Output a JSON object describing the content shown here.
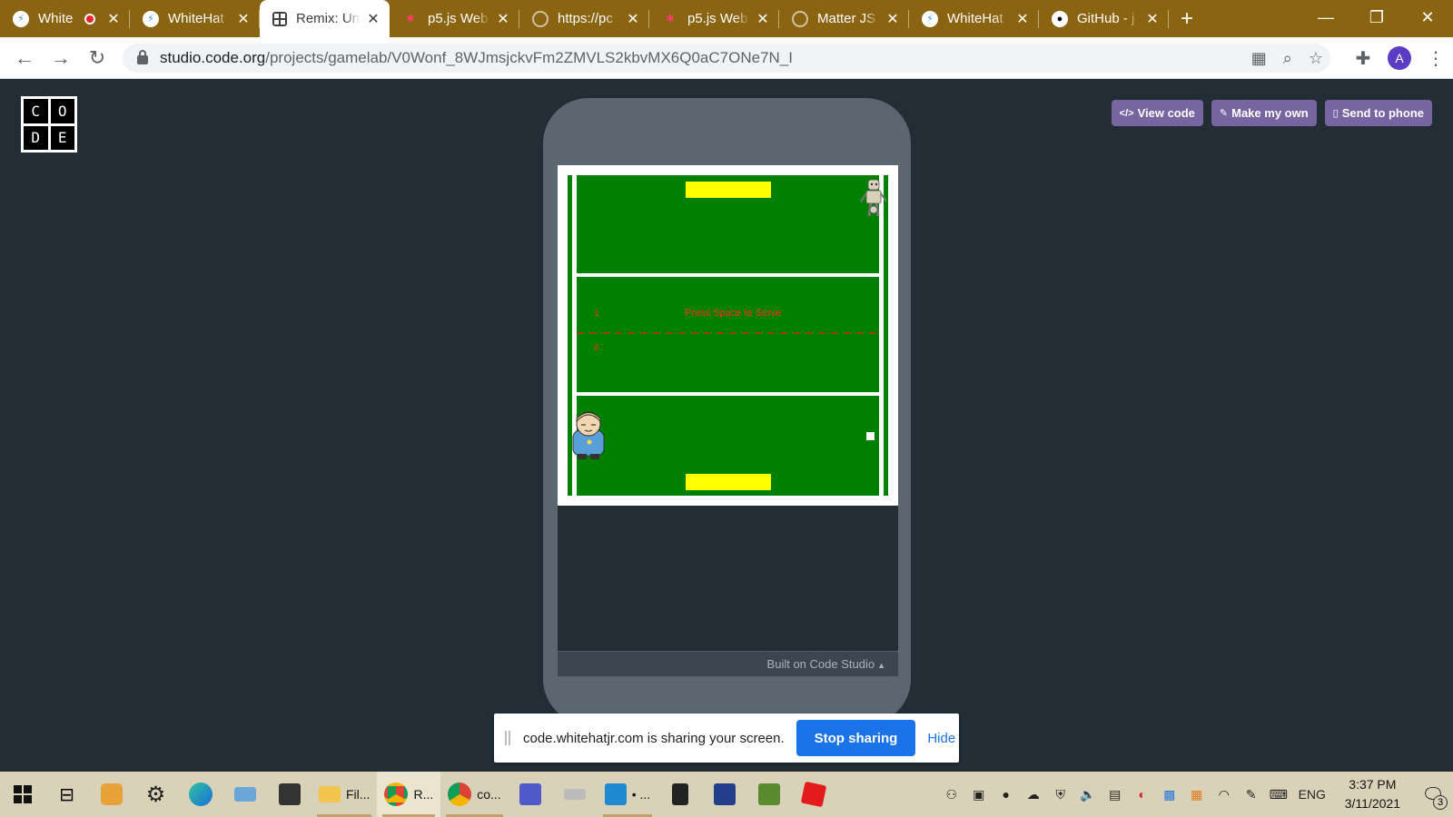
{
  "browser": {
    "tabs": [
      {
        "title": "White",
        "icon": "whitehat-icon",
        "recording": true
      },
      {
        "title": "WhiteHat",
        "icon": "whitehat-icon"
      },
      {
        "title": "Remix: Un",
        "icon": "remix-grid-icon",
        "active": true
      },
      {
        "title": "p5.js Web",
        "icon": "p5js-star-icon"
      },
      {
        "title": "https://pc",
        "icon": "globe-icon"
      },
      {
        "title": "p5.js Web",
        "icon": "p5js-star-icon"
      },
      {
        "title": "Matter JS",
        "icon": "globe-icon"
      },
      {
        "title": "WhiteHat",
        "icon": "whitehat-icon"
      },
      {
        "title": "GitHub - j",
        "icon": "github-icon"
      }
    ],
    "close_glyph": "✕",
    "new_tab_glyph": "+",
    "url_host": "studio.code.org",
    "url_path": "/projects/gamelab/V0Wonf_8WJmsjckvFm2ZMVLS2kbvMX6Q0aC7ONe7N_I",
    "profile_initial": "A"
  },
  "page": {
    "logo_letters": [
      "C",
      "O",
      "D",
      "E"
    ],
    "buttons": {
      "view_code": "View code",
      "make_my_own": "Make my own",
      "send_to_phone": "Send to phone"
    },
    "game": {
      "top_score": "1",
      "bottom_score": "0",
      "message": "Press Space to Serve",
      "court_color": "#008000",
      "goal_color": "#ffff00",
      "text_color": "#ff2a2a"
    },
    "built_on": "Built on Code Studio"
  },
  "share_bar": {
    "message": "code.whitehatjr.com is sharing your screen.",
    "stop_label": "Stop sharing",
    "hide_label": "Hide"
  },
  "taskbar": {
    "apps": [
      {
        "name": "file-explorer",
        "label": "Fil..."
      },
      {
        "name": "chrome-remix",
        "label": "R..."
      },
      {
        "name": "chrome-code",
        "label": "co..."
      },
      {
        "name": "vscode",
        "label": "• ..."
      }
    ],
    "language": "ENG",
    "time": "3:37 PM",
    "date": "3/11/2021",
    "notification_count": "3"
  }
}
